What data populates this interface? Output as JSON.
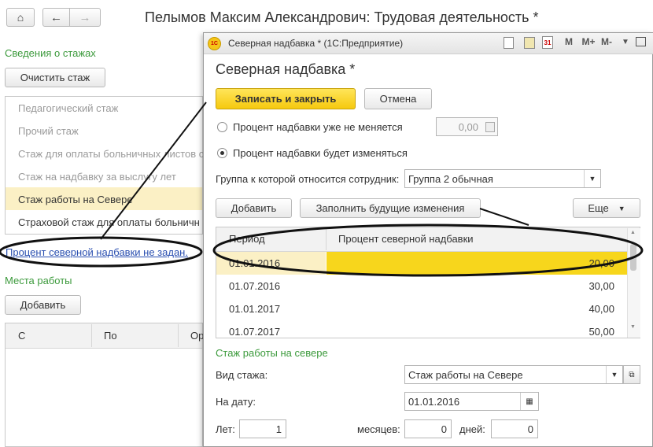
{
  "main": {
    "title": "Пелымов Максим Александрович: Трудовая деятельность *",
    "section_stazh": "Сведения о стажах",
    "clear_button": "Очистить стаж",
    "stazh_list": [
      "Педагогический стаж",
      "Прочий стаж",
      "Стаж для оплаты больничных листов с",
      "Стаж на надбавку за выслугу лет",
      "Стаж работы на Севере",
      "Страховой стаж для оплаты больничн"
    ],
    "link_percent": "Процент северной надбавки не задан.",
    "section_work": "Места работы",
    "add_button": "Добавить",
    "table_cols": [
      "С",
      "По",
      "Ор"
    ]
  },
  "dialog": {
    "window_title": "Северная надбавка * (1С:Предприятие)",
    "toolbar_icons": [
      "M",
      "M+",
      "M-"
    ],
    "heading": "Северная надбавка *",
    "save_close": "Записать и закрыть",
    "cancel": "Отмена",
    "radio1_label": "Процент надбавки уже не меняется",
    "radio1_value": "0,00",
    "radio2_label": "Процент надбавки будет изменяться",
    "group_label": "Группа к которой относится сотрудник:",
    "group_value": "Группа 2 обычная",
    "add_btn": "Добавить",
    "fill_btn": "Заполнить будущие изменения",
    "more_btn": "Еще",
    "table": {
      "col_period": "Период",
      "col_percent": "Процент северной надбавки",
      "rows": [
        {
          "period": "01.01.2016",
          "percent": "20,00"
        },
        {
          "period": "01.07.2016",
          "percent": "30,00"
        },
        {
          "period": "01.01.2017",
          "percent": "40,00"
        },
        {
          "period": "01.07.2017",
          "percent": "50,00"
        }
      ]
    },
    "section_north": "Стаж работы на севере",
    "vid_label": "Вид стажа:",
    "vid_value": "Стаж работы на Севере",
    "date_label": "На дату:",
    "date_value": "01.01.2016",
    "years_label": "Лет:",
    "years_value": "1",
    "months_label": "месяцев:",
    "months_value": "0",
    "days_label": "дней:",
    "days_value": "0"
  }
}
